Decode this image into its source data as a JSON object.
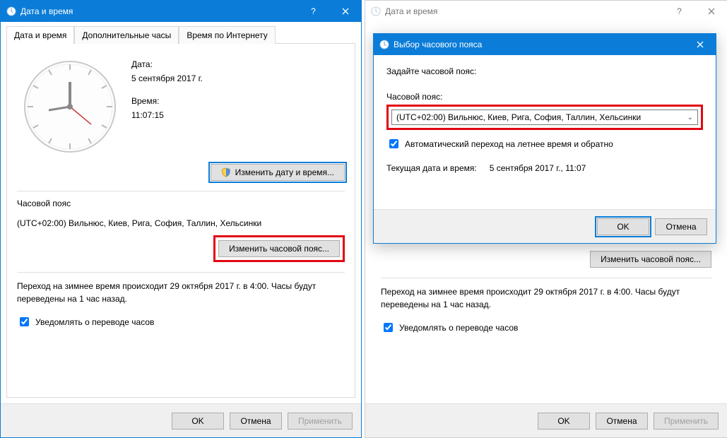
{
  "left": {
    "title": "Дата и время",
    "tabs": [
      "Дата и время",
      "Дополнительные часы",
      "Время по Интернету"
    ],
    "date_label": "Дата:",
    "date_value": "5 сентября 2017 г.",
    "time_label": "Время:",
    "time_value": "11:07:15",
    "change_dt_btn": "Изменить дату и время...",
    "tz_heading": "Часовой пояс",
    "tz_value": "(UTC+02:00) Вильнюс, Киев, Рига, София, Таллин, Хельсинки",
    "change_tz_btn": "Изменить часовой пояс...",
    "dst_info": "Переход на зимнее время происходит 29 октября 2017 г. в 4:00. Часы будут переведены на 1 час назад.",
    "notify_label": "Уведомлять о переводе часов",
    "ok": "OK",
    "cancel": "Отмена",
    "apply": "Применить"
  },
  "right": {
    "title": "Дата и время",
    "change_tz_btn": "Изменить часовой пояс...",
    "dst_info": "Переход на зимнее время происходит 29 октября 2017 г. в 4:00. Часы будут переведены на 1 час назад.",
    "notify_label": "Уведомлять о переводе часов",
    "ok": "OK",
    "cancel": "Отмена",
    "apply": "Применить"
  },
  "modal": {
    "title": "Выбор часового пояса",
    "prompt": "Задайте часовой пояс:",
    "combo_label": "Часовой пояс:",
    "combo_value": "(UTC+02:00) Вильнюс, Киев, Рига, София, Таллин, Хельсинки",
    "auto_dst": "Автоматический переход на летнее время и обратно",
    "current_label": "Текущая дата и время:",
    "current_value": "5 сентября 2017 г., 11:07",
    "ok": "OK",
    "cancel": "Отмена"
  }
}
